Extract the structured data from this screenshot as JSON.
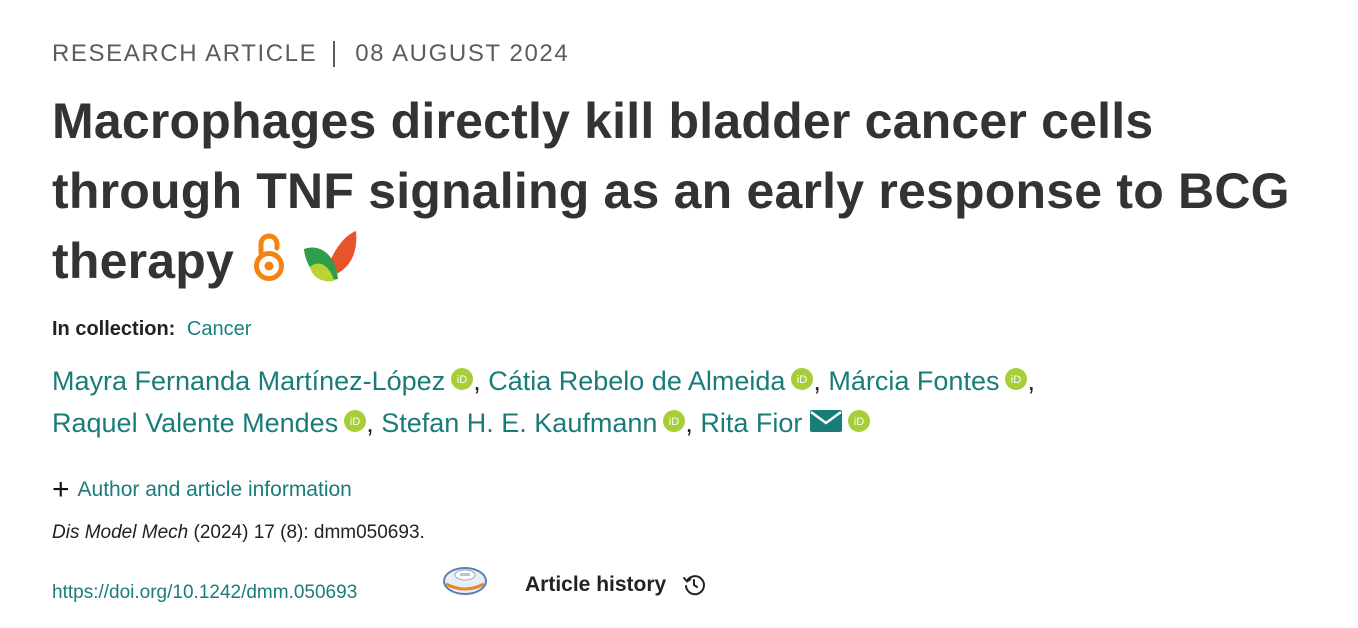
{
  "header": {
    "article_type": "RESEARCH ARTICLE",
    "separator": "|",
    "date": "08 AUGUST 2024"
  },
  "title": {
    "text": "Macrophages directly kill bladder cancer cells through TNF signaling as an early response to BCG therapy",
    "icons": [
      "open-access-icon",
      "free-access-leaf-icon"
    ]
  },
  "collection": {
    "label": "In collection:",
    "link": "Cancer"
  },
  "authors": [
    {
      "name": "Mayra Fernanda Martínez-López",
      "orcid": true,
      "email": false,
      "sep": ", "
    },
    {
      "name": "Cátia Rebelo de Almeida",
      "orcid": true,
      "email": false,
      "sep": ", "
    },
    {
      "name": "Márcia Fontes",
      "orcid": true,
      "email": false,
      "sep": ","
    },
    {
      "name": "Raquel Valente Mendes",
      "orcid": true,
      "email": false,
      "sep": ", "
    },
    {
      "name": "Stefan H. E. Kaufmann",
      "orcid": true,
      "email": false,
      "sep": ", "
    },
    {
      "name": "Rita Fior",
      "orcid": true,
      "email": true,
      "sep": ""
    }
  ],
  "author_info": {
    "toggle": "+",
    "label": "Author and article information"
  },
  "citation": {
    "journal": "Dis Model Mech",
    "rest": " (2024) 17 (8): dmm050693."
  },
  "doi": {
    "url": "https://doi.org/10.1242/dmm.050693"
  },
  "history": {
    "label": "Article history"
  },
  "colors": {
    "link": "#1a7c79",
    "orcid": "#a6ce39",
    "open_access": "#f68212"
  }
}
